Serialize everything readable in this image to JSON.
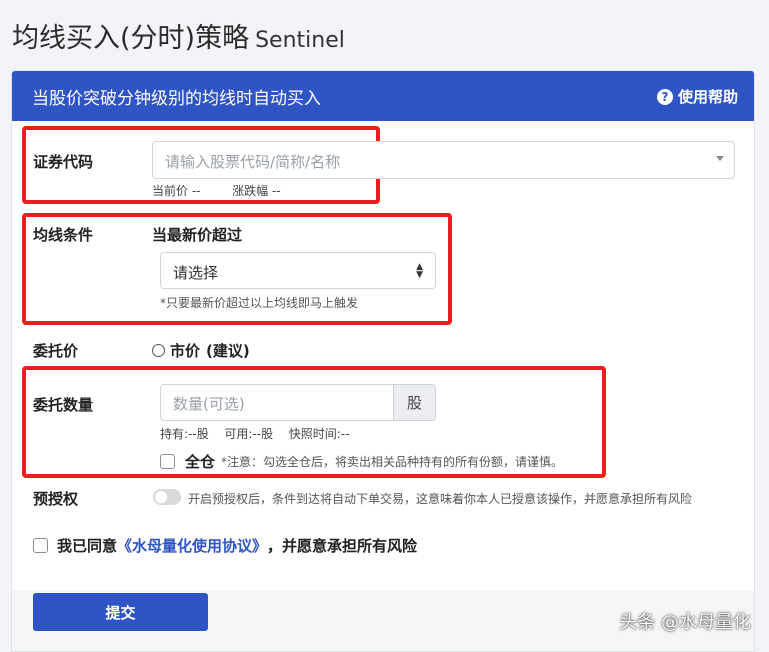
{
  "header": {
    "title": "均线买入(分时)策略",
    "subtitle": "Sentinel"
  },
  "banner": {
    "text": "当股价突破分钟级别的均线时自动买入",
    "help_label": "使用帮助",
    "help_icon": "question-circle-icon"
  },
  "security": {
    "label": "证券代码",
    "placeholder": "请输入股票代码/简称/名称",
    "current_price_label": "当前价",
    "current_price_value": "--",
    "change_label": "涨跌幅",
    "change_value": "--"
  },
  "ma_condition": {
    "label": "均线条件",
    "sub_label": "当最新价超过",
    "select_value": "请选择",
    "hint": "*只要最新价超过以上均线即马上触发"
  },
  "order_price": {
    "label": "委托价",
    "option_label": "市价",
    "option_note": "(建议)"
  },
  "quantity": {
    "label": "委托数量",
    "placeholder": "数量(可选)",
    "unit": "股",
    "holdings_label": "持有:",
    "holdings_value": "--股",
    "available_label": "可用:",
    "available_value": "--股",
    "snapshot_label": "快照时间:",
    "snapshot_value": "--",
    "full_position_label": "全仓",
    "full_position_note": "*注意：勾选全仓后，将卖出相关品种持有的所有份额，请谨慎。"
  },
  "preauth": {
    "label": "预授权",
    "description": "开启预授权后，条件到达将自动下单交易，这意味着你本人已授意该操作，并愿意承担所有风险",
    "enabled": false
  },
  "agreement": {
    "prefix": "我已同意",
    "link_text": "《水母量化使用协议》",
    "suffix": "，并愿意承担所有风险",
    "checked": false
  },
  "actions": {
    "submit_label": "提交"
  },
  "watermark": "头条 @水母量化",
  "colors": {
    "brand_blue": "#2f54c4",
    "highlight_red": "#ee1c1c",
    "page_bg": "#f3f4f8"
  }
}
